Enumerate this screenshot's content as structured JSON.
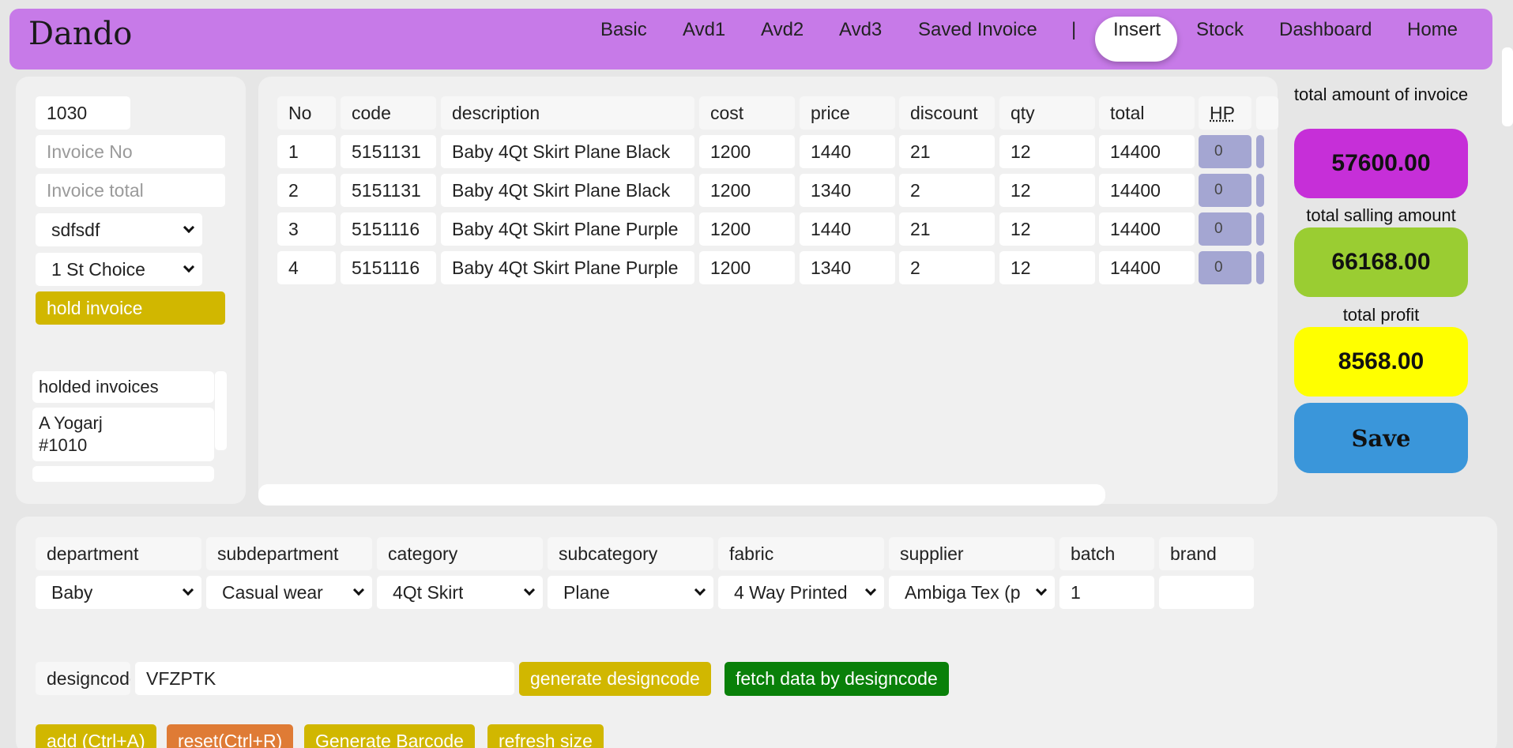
{
  "nav": {
    "brand": "Dando",
    "items": [
      "Basic",
      "Avd1",
      "Avd2",
      "Avd3",
      "Saved Invoice",
      "|",
      "Insert",
      "Stock",
      "Dashboard",
      "Home"
    ],
    "active": "Insert"
  },
  "left": {
    "invoice_id_value": "1030",
    "invoice_no_placeholder": "Invoice No",
    "invoice_total_placeholder": "Invoice total",
    "customer_select": "sdfsdf",
    "choice_select": "1 St Choice",
    "hold_button": "hold invoice",
    "held_header": "holded invoices",
    "held_items": [
      {
        "name": "A Yogarj",
        "number": "#1010"
      }
    ]
  },
  "table": {
    "headers": [
      "No",
      "code",
      "description",
      "cost",
      "price",
      "discount",
      "qty",
      "total",
      "HP"
    ],
    "rows": [
      {
        "no": "1",
        "code": "5151131",
        "description": "Baby 4Qt Skirt Plane Black",
        "cost": "1200",
        "price": "1440",
        "discount": "21",
        "qty": "12",
        "total": "14400",
        "hp": "0"
      },
      {
        "no": "2",
        "code": "5151131",
        "description": "Baby 4Qt Skirt Plane Black",
        "cost": "1200",
        "price": "1340",
        "discount": "2",
        "qty": "12",
        "total": "14400",
        "hp": "0"
      },
      {
        "no": "3",
        "code": "5151116",
        "description": "Baby 4Qt Skirt Plane Purple",
        "cost": "1200",
        "price": "1440",
        "discount": "21",
        "qty": "12",
        "total": "14400",
        "hp": "0"
      },
      {
        "no": "4",
        "code": "5151116",
        "description": "Baby 4Qt Skirt Plane Purple",
        "cost": "1200",
        "price": "1340",
        "discount": "2",
        "qty": "12",
        "total": "14400",
        "hp": "0"
      }
    ]
  },
  "summary": {
    "invoice_label": "total amount of invoice",
    "invoice_value": "57600.00",
    "selling_label": "total salling amount",
    "selling_value": "66168.00",
    "profit_label": "total profit",
    "profit_value": "8568.00",
    "save_button": "Save",
    "colors": {
      "invoice": "#c62fd8",
      "selling": "#9acd32",
      "profit": "#ffff00",
      "save": "#3a96da"
    }
  },
  "form": {
    "labels": [
      "department",
      "subdepartment",
      "category",
      "subcategory",
      "fabric",
      "supplier",
      "batch",
      "brand"
    ],
    "values": [
      "Baby",
      "Casual wear",
      "4Qt Skirt",
      "Plane",
      "4 Way Printed",
      "Ambiga Tex (p",
      "1",
      ""
    ],
    "designcode_label": "designcode",
    "designcode_value": "VFZPTK",
    "generate_button": "generate designcode",
    "fetch_button": "fetch data by designcode",
    "add_button": "add (Ctrl+A)",
    "reset_button": "reset(Ctrl+R)",
    "barcode_button": "Generate Barcode",
    "refresh_button": "refresh size"
  }
}
